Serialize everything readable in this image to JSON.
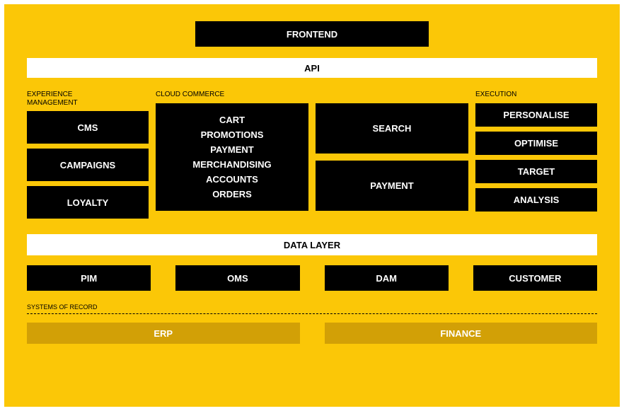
{
  "frontend": "FRONTEND",
  "api": "API",
  "sections": {
    "experience_label": "EXPERIENCE\nMANAGEMENT",
    "cloud_label": "CLOUD COMMERCE",
    "execution_label": "EXECUTION",
    "records_label": "SYSTEMS OF RECORD"
  },
  "experience": {
    "cms": "CMS",
    "campaigns": "CAMPAIGNS",
    "loyalty": "LOYALTY"
  },
  "cloud_commerce": {
    "items": {
      "cart": "CART",
      "promotions": "PROMOTIONS",
      "payment": "PAYMENT",
      "merchandising": "MERCHANDISING",
      "accounts": "ACCOUNTS",
      "orders": "ORDERS"
    },
    "right": {
      "search": "SEARCH",
      "payment": "PAYMENT"
    }
  },
  "execution": {
    "personalise": "PERSONALISE",
    "optimise": "OPTIMISE",
    "target": "TARGET",
    "analysis": "ANALYSIS"
  },
  "data_layer": "DATA LAYER",
  "systems": {
    "pim": "PIM",
    "oms": "OMS",
    "dam": "DAM",
    "customer": "CUSTOMER"
  },
  "records": {
    "erp": "ERP",
    "finance": "FINANCE"
  }
}
